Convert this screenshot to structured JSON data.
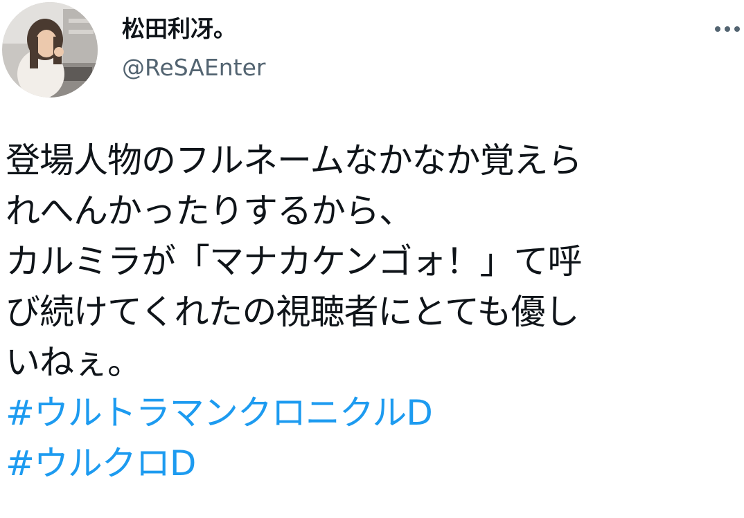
{
  "tweet": {
    "display_name": "松田利冴。",
    "handle": "@ReSAEnter",
    "more_icon": "more-horizontal-icon",
    "text_lines": [
      "登場人物のフルネームなかなか覚えら",
      "れへんかったりするから、",
      "カルミラが「マナカケンゴォ！」て呼",
      "び続けてくれたの視聴者にとても優し",
      "いねぇ。"
    ],
    "hashtags": [
      "#ウルトラマンクロニクルD",
      "#ウルクロD"
    ]
  },
  "colors": {
    "text": "#0f1419",
    "secondary": "#536471",
    "hashtag": "#1d9bf0",
    "background": "#ffffff"
  }
}
